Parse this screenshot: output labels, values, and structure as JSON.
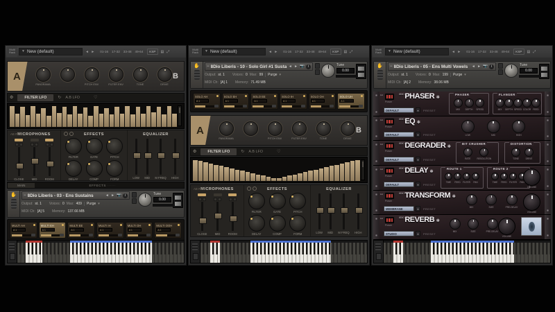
{
  "colors": {
    "accent_tan": "#b29a78",
    "keyswitch_red": "#b23530",
    "range_blue": "#4a6fd0",
    "power_red": "#c23a34",
    "preset_blue": "#9aa3b5"
  },
  "multi_header": {
    "corner": "Multi Rack",
    "preset": "New (default)",
    "banks": [
      "01-16",
      "17-32",
      "33-48",
      "49-64"
    ],
    "ksp": "KSP",
    "aux_icon": "aux",
    "resize_icon": "resize"
  },
  "labels": {
    "output": "Output:",
    "voices": "Voices:",
    "max": "Max:",
    "purge": "Purge",
    "midi": "MIDI Ch:",
    "memory": "Memory:",
    "tune": "Tune",
    "power": "Power",
    "preset": "PRESET",
    "brand": "8DIO"
  },
  "mixer": {
    "mics_header": "MICROPHONES",
    "ab_rnd": "AB RND",
    "mic_faders": [
      "CLOSE",
      "MID",
      "ROOM"
    ],
    "effects_header": "EFFECTS",
    "fx_top": [
      "FILTER",
      "GATE",
      "PITCH"
    ],
    "fx_bottom": [
      "DELAY",
      "COMP",
      "FORM"
    ],
    "eq_header": "EQUALIZER",
    "eq_faders": [
      "LOW",
      "MID",
      "M FREQ",
      "HIGH"
    ]
  },
  "ab_knobs": [
    "PANORAMA",
    "",
    "PITCH ENV",
    "FILTER ENV",
    "TONE",
    "DRIVE"
  ],
  "lfo": {
    "tab1": "FILTER LFO",
    "tab2": "A.B LFO"
  },
  "page_tabs": {
    "main": "MAIN",
    "effects": "EFFECTS"
  },
  "left": {
    "instrument": {
      "title": "8Dio Liberis - 03 - Ens Sustains",
      "output": "st. 1",
      "voices": "0",
      "max": "409",
      "midi": "[A] 5",
      "memory": "137.66 MB",
      "tune": "0.00"
    },
    "vowels": [
      "MULTI AH",
      "MULTI EH",
      "MULTI EE",
      "MULTI IH",
      "MULTI OH",
      "MULTI OOH"
    ],
    "seq": [
      0.95,
      0.58,
      0.9,
      0.52,
      0.95,
      0.6,
      0.85,
      0.5,
      0.95,
      0.64,
      0.9,
      0.55,
      0.95,
      0.6,
      0.88,
      0.5,
      0.95,
      0.6,
      0.84,
      0.55,
      0.9,
      0.6,
      0.95,
      0.55,
      0.9,
      0.6,
      0.95,
      0.65,
      0.9,
      0.55,
      0.95,
      0.6
    ]
  },
  "middle": {
    "instrument": {
      "title": "8Dio Liberis - 10 - Solo Girl #1 Susta",
      "output": "st. 1",
      "voices": "0",
      "max": "99",
      "midi": "[A] 1",
      "memory": "71.49 MB",
      "tune": "0.00"
    },
    "vowels": [
      "SOLO AH",
      "SOLO EH",
      "SOLO EE",
      "SOLO IH",
      "SOLO OH",
      "SOLO UH"
    ],
    "seq": [
      0.95,
      0.9,
      0.84,
      0.79,
      0.73,
      0.68,
      0.62,
      0.57,
      0.51,
      0.46,
      0.4,
      0.35,
      0.29,
      0.24,
      0.18,
      0.13,
      0.13,
      0.18,
      0.24,
      0.29,
      0.35,
      0.4,
      0.46,
      0.51,
      0.57,
      0.62,
      0.68,
      0.73,
      0.79,
      0.84,
      0.9,
      0.95
    ]
  },
  "right": {
    "instrument": {
      "title": "8Dio Liberis - 05 - Ens Multi Vowels",
      "output": "st. 1",
      "voices": "0",
      "max": "199",
      "midi": "[A] 2",
      "memory": "38.06 MB",
      "tune": "0.00"
    },
    "rack": [
      {
        "name": "PHASER",
        "preset": "DEFAULT",
        "sections": [
          {
            "label": "PHASER",
            "knobs": [
              "MIX",
              "DEPTH",
              "SPEED"
            ]
          },
          {
            "label": "FLANGER",
            "knobs": [
              "MIX",
              "DEPTH",
              "SPEED",
              "COLOR",
              "FEED"
            ]
          }
        ]
      },
      {
        "name": "EQ",
        "preset": "DEFAULT",
        "knobs": [
          "LOW",
          "MID",
          "HIGH"
        ]
      },
      {
        "name": "DEGRADER",
        "preset": "DEFAULT",
        "sections": [
          {
            "label": "BIT CRUSHER",
            "knobs": [
              "RATE",
              "RESOLUTION"
            ]
          },
          {
            "label": "DISTORTION",
            "knobs": [
              "TONE",
              "DRIVE"
            ]
          }
        ]
      },
      {
        "name": "DELAY",
        "preset": "DEFAULT",
        "sections": [
          {
            "label": "ROUTE 1",
            "knobs": [
              "TIME",
              "FEED",
              "FILTER",
              "PAN"
            ]
          },
          {
            "label": "ROUTE 2",
            "knobs": [
              "TIME",
              "FEED",
              "FILTER",
              "PAN"
            ]
          }
        ],
        "big": "VOLUME"
      },
      {
        "name": "TRANSFORM",
        "preset": "MEMBRANE",
        "knobs": [
          "MIX",
          "SIZE",
          "PRE-DELAY"
        ],
        "big": "VOLUME"
      },
      {
        "name": "REVERB",
        "preset": "STUDIO",
        "knobs": [
          "MIX",
          "SIZE",
          "PRE-DELAY"
        ],
        "big": "VOLUME"
      }
    ]
  }
}
